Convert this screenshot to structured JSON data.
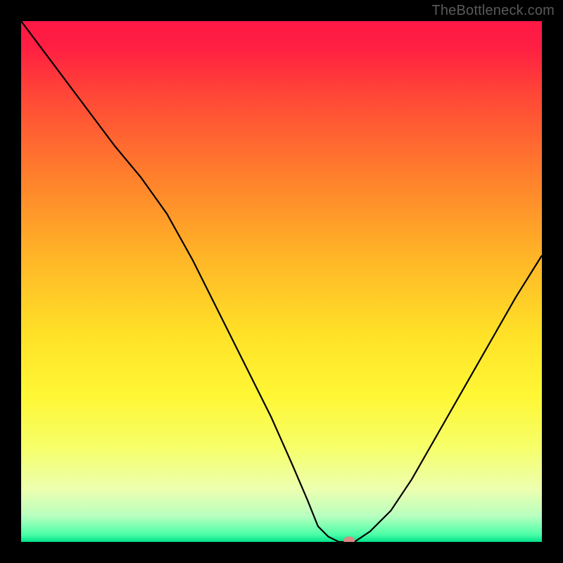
{
  "watermark": "TheBottleneck.com",
  "chart_data": {
    "type": "line",
    "title": "",
    "xlabel": "",
    "ylabel": "",
    "xlim": [
      0,
      100
    ],
    "ylim": [
      0,
      100
    ],
    "background_gradient": {
      "stops": [
        {
          "offset": 0.0,
          "color": "#ff1846"
        },
        {
          "offset": 0.05,
          "color": "#ff1f42"
        },
        {
          "offset": 0.15,
          "color": "#ff4a36"
        },
        {
          "offset": 0.3,
          "color": "#ff802c"
        },
        {
          "offset": 0.45,
          "color": "#ffb427"
        },
        {
          "offset": 0.6,
          "color": "#ffe127"
        },
        {
          "offset": 0.72,
          "color": "#fff735"
        },
        {
          "offset": 0.82,
          "color": "#f6ff6a"
        },
        {
          "offset": 0.9,
          "color": "#ecffb0"
        },
        {
          "offset": 0.95,
          "color": "#b8ffbf"
        },
        {
          "offset": 0.985,
          "color": "#4fffa8"
        },
        {
          "offset": 1.0,
          "color": "#00e28a"
        }
      ]
    },
    "grid": false,
    "legend": false,
    "series": [
      {
        "name": "bottleneck-curve",
        "color": "#000000",
        "width": 2.2,
        "x": [
          0,
          6,
          12,
          18,
          23,
          28,
          33,
          38,
          43,
          48,
          52,
          55,
          57,
          59,
          61,
          64,
          67,
          71,
          75,
          79,
          83,
          87,
          91,
          95,
          100
        ],
        "values": [
          100,
          92,
          84,
          76,
          70,
          63,
          54,
          44,
          34,
          24,
          15,
          8,
          3,
          1,
          0,
          0,
          2,
          6,
          12,
          19,
          26,
          33,
          40,
          47,
          55
        ]
      }
    ],
    "marker": {
      "name": "current-point",
      "x": 63,
      "y": 0,
      "color": "#d88a84",
      "rx": 8,
      "ry": 6
    }
  }
}
